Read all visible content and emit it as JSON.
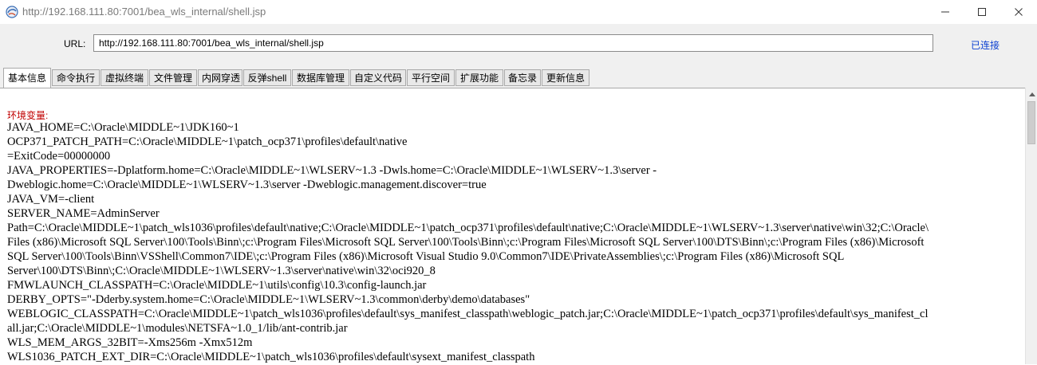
{
  "window": {
    "title": "http://192.168.111.80:7001/bea_wls_internal/shell.jsp"
  },
  "urlbar": {
    "label": "URL:",
    "value": "http://192.168.111.80:7001/bea_wls_internal/shell.jsp",
    "status": "已连接"
  },
  "tabs": [
    {
      "label": "基本信息"
    },
    {
      "label": "命令执行"
    },
    {
      "label": "虚拟终端"
    },
    {
      "label": "文件管理"
    },
    {
      "label": "内网穿透"
    },
    {
      "label": "反弹shell"
    },
    {
      "label": "数据库管理"
    },
    {
      "label": "自定义代码"
    },
    {
      "label": "平行空间"
    },
    {
      "label": "扩展功能"
    },
    {
      "label": "备忘录"
    },
    {
      "label": "更新信息"
    }
  ],
  "content": {
    "heading": "环境变量:",
    "lines": [
      "JAVA_HOME=C:\\Oracle\\MIDDLE~1\\JDK160~1",
      "OCP371_PATCH_PATH=C:\\Oracle\\MIDDLE~1\\patch_ocp371\\profiles\\default\\native",
      "=ExitCode=00000000",
      "JAVA_PROPERTIES=-Dplatform.home=C:\\Oracle\\MIDDLE~1\\WLSERV~1.3 -Dwls.home=C:\\Oracle\\MIDDLE~1\\WLSERV~1.3\\server -",
      "Dweblogic.home=C:\\Oracle\\MIDDLE~1\\WLSERV~1.3\\server -Dweblogic.management.discover=true",
      "JAVA_VM=-client",
      "SERVER_NAME=AdminServer",
      "Path=C:\\Oracle\\MIDDLE~1\\patch_wls1036\\profiles\\default\\native;C:\\Oracle\\MIDDLE~1\\patch_ocp371\\profiles\\default\\native;C:\\Oracle\\MIDDLE~1\\WLSERV~1.3\\server\\native\\win\\32;C:\\Oracle\\",
      "Files (x86)\\Microsoft SQL Server\\100\\Tools\\Binn\\;c:\\Program Files\\Microsoft SQL Server\\100\\Tools\\Binn\\;c:\\Program Files\\Microsoft SQL Server\\100\\DTS\\Binn\\;c:\\Program Files (x86)\\Microsoft",
      "SQL Server\\100\\Tools\\Binn\\VSShell\\Common7\\IDE\\;c:\\Program Files (x86)\\Microsoft Visual Studio 9.0\\Common7\\IDE\\PrivateAssemblies\\;c:\\Program Files (x86)\\Microsoft SQL",
      "Server\\100\\DTS\\Binn\\;C:\\Oracle\\MIDDLE~1\\WLSERV~1.3\\server\\native\\win\\32\\oci920_8",
      "FMWLAUNCH_CLASSPATH=C:\\Oracle\\MIDDLE~1\\utils\\config\\10.3\\config-launch.jar",
      "DERBY_OPTS=\"-Dderby.system.home=C:\\Oracle\\MIDDLE~1\\WLSERV~1.3\\common\\derby\\demo\\databases\"",
      "WEBLOGIC_CLASSPATH=C:\\Oracle\\MIDDLE~1\\patch_wls1036\\profiles\\default\\sys_manifest_classpath\\weblogic_patch.jar;C:\\Oracle\\MIDDLE~1\\patch_ocp371\\profiles\\default\\sys_manifest_cl",
      "all.jar;C:\\Oracle\\MIDDLE~1\\modules\\NETSFA~1.0_1/lib/ant-contrib.jar",
      "WLS_MEM_ARGS_32BIT=-Xms256m -Xmx512m",
      "WLS1036_PATCH_EXT_DIR=C:\\Oracle\\MIDDLE~1\\patch_wls1036\\profiles\\default\\sysext_manifest_classpath"
    ]
  }
}
